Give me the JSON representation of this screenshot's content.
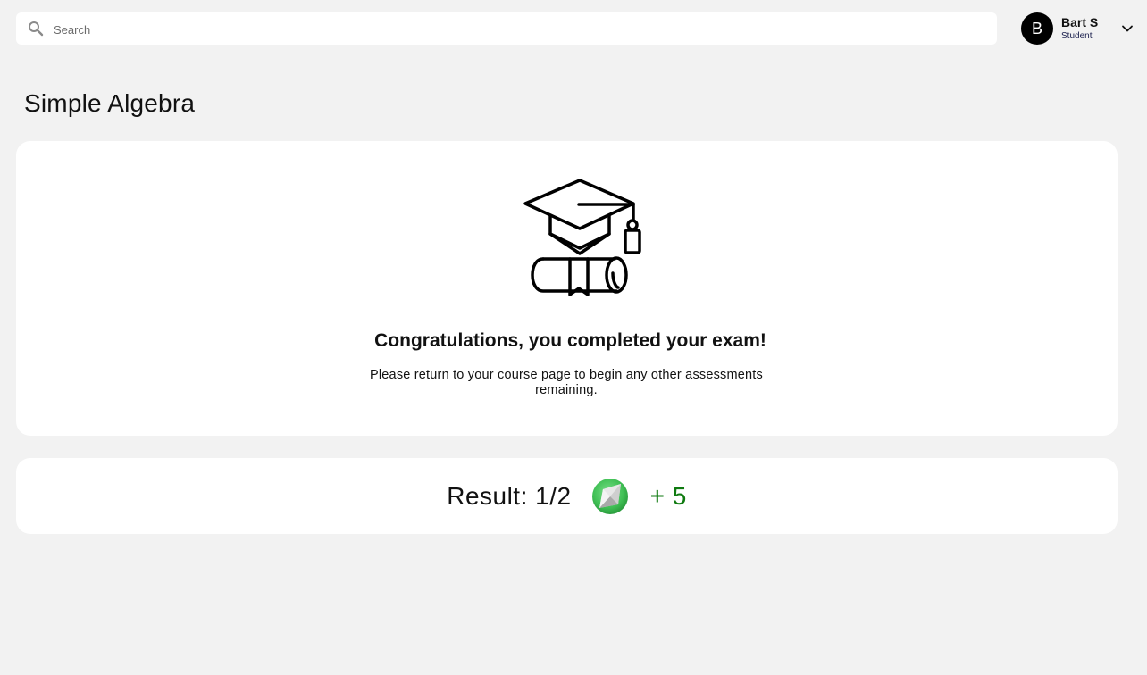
{
  "search": {
    "placeholder": "Search",
    "icon": "search-icon"
  },
  "user": {
    "initial": "B",
    "name": "Bart S",
    "role": "Student",
    "menu_icon": "chevron-down-icon"
  },
  "page": {
    "title": "Simple Algebra"
  },
  "completion": {
    "icon": "graduation-icon",
    "heading": "Congratulations, you completed your exam!",
    "message": "Please return to your course page to begin any other assessments remaining."
  },
  "result": {
    "label": "Result: 1/2",
    "icon": "gem-icon",
    "points": "+ 5",
    "points_color": "#0f7a10"
  }
}
